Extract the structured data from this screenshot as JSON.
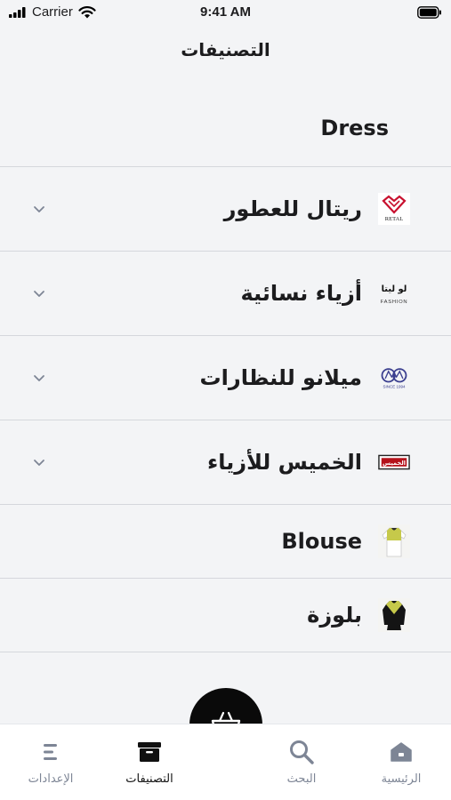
{
  "status_bar": {
    "carrier": "Carrier",
    "time": "9:41 AM"
  },
  "header": {
    "title": "التصنيفات"
  },
  "categories": [
    {
      "label": "Dress",
      "has_thumb": false,
      "expandable": false,
      "thumb": ""
    },
    {
      "label": "ريتال للعطور",
      "has_thumb": true,
      "expandable": true,
      "thumb": "retal-logo",
      "thumb_text": "RETAL"
    },
    {
      "label": "أزياء نسائية",
      "has_thumb": true,
      "expandable": true,
      "thumb": "lolita-logo",
      "thumb_text": "لو ليتا",
      "thumb_sub": "FASHION"
    },
    {
      "label": "ميلانو للنظارات",
      "has_thumb": true,
      "expandable": true,
      "thumb": "milano-logo",
      "thumb_sub": "SINCE 1994"
    },
    {
      "label": "الخميس للأزياء",
      "has_thumb": true,
      "expandable": true,
      "thumb": "alkhamis-logo",
      "thumb_text": "الخميس"
    },
    {
      "label": "Blouse",
      "has_thumb": true,
      "expandable": false,
      "thumb": "blouse-photo"
    },
    {
      "label": "بلوزة",
      "has_thumb": true,
      "expandable": false,
      "thumb": "blouse-dark-photo"
    }
  ],
  "tabbar": {
    "tabs": [
      {
        "label": "الإعدادات",
        "icon": "settings-lines-icon",
        "active": false
      },
      {
        "label": "التصنيفات",
        "icon": "archive-box-icon",
        "active": true
      },
      {
        "label": "البحث",
        "icon": "search-icon",
        "active": false
      },
      {
        "label": "الرئيسية",
        "icon": "home-icon",
        "active": false
      }
    ],
    "fab_icon": "basket-icon"
  },
  "colors": {
    "background": "#f3f4f6",
    "active": "#111111",
    "inactive": "#7d8595",
    "retal_red": "#c8102e"
  }
}
